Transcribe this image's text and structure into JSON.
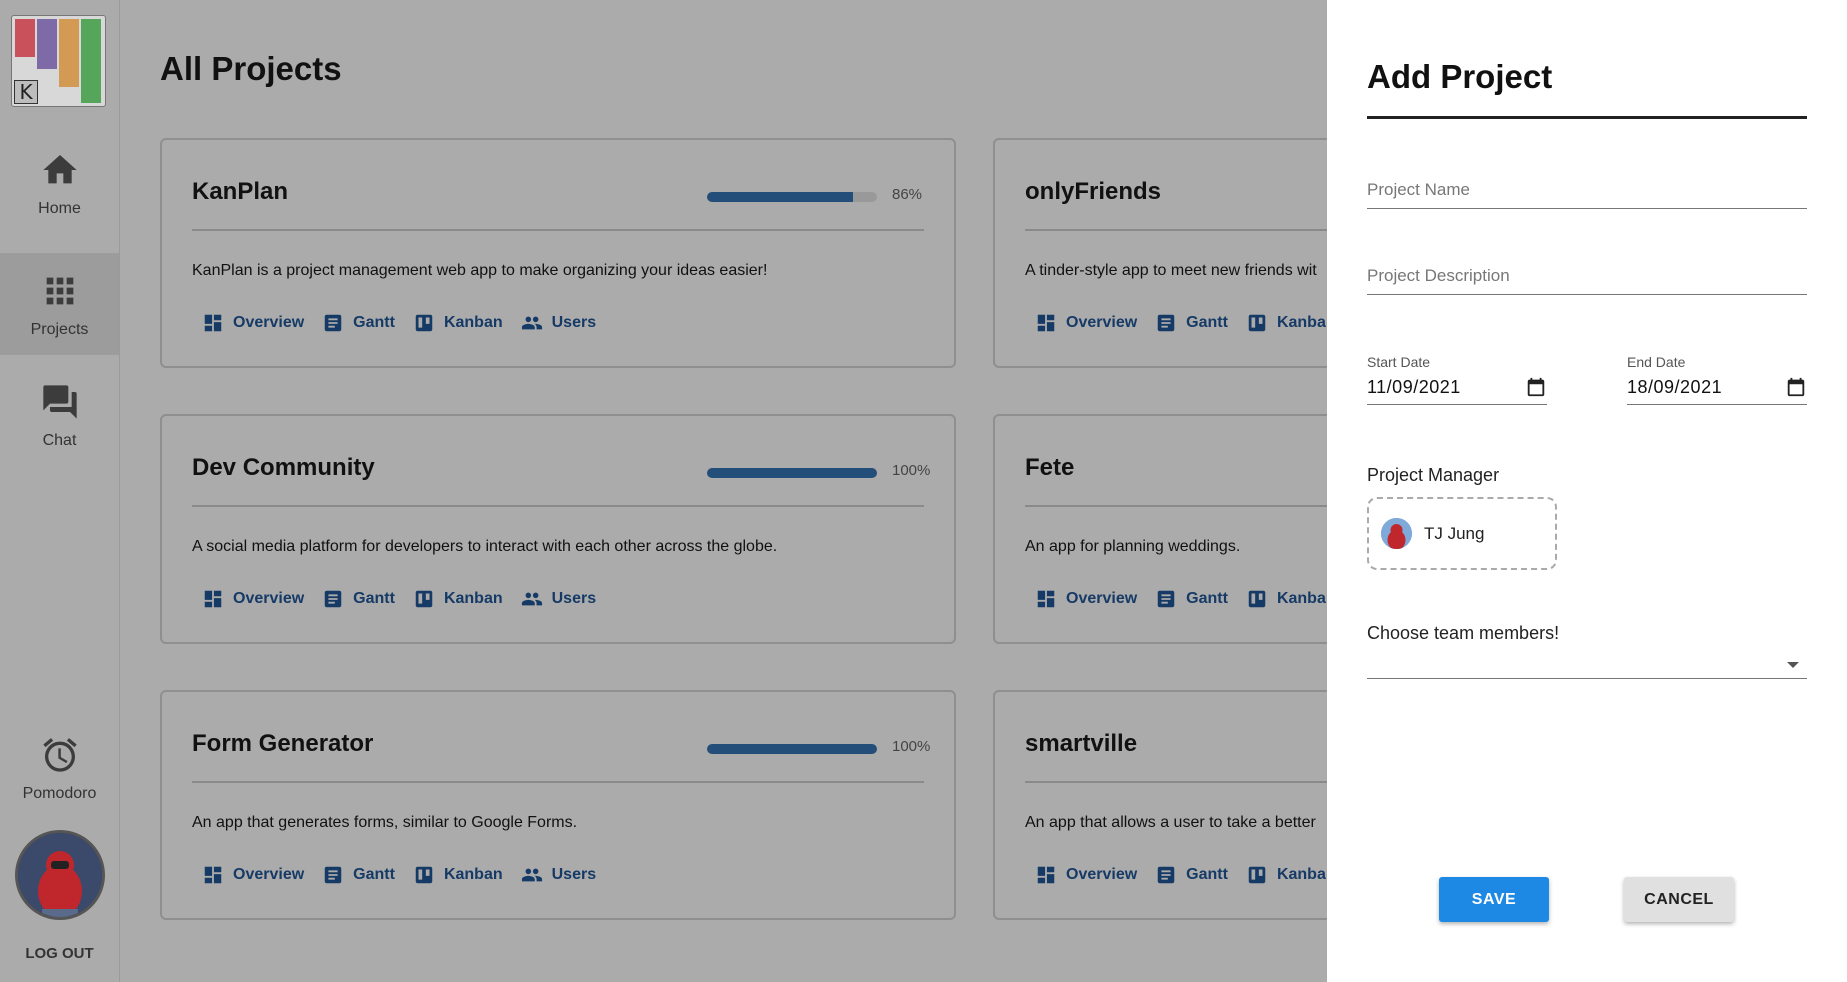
{
  "sidebar": {
    "logo_letter": "K",
    "logo_colors": [
      "#c8515b",
      "#7d6aa6",
      "#d29a52",
      "#55a55b"
    ],
    "items": [
      {
        "label": "Home",
        "icon": "home-icon"
      },
      {
        "label": "Projects",
        "icon": "apps-grid-icon",
        "active": true
      },
      {
        "label": "Chat",
        "icon": "chat-icon"
      }
    ],
    "pomodoro_label": "Pomodoro",
    "logout_label": "LOG OUT"
  },
  "main": {
    "title": "All Projects",
    "link_labels": {
      "overview": "Overview",
      "gantt": "Gantt",
      "kanban": "Kanban",
      "users": "Users"
    },
    "projects": [
      {
        "name": "KanPlan",
        "progress_pct": "86%",
        "progress": 0.86,
        "description": "KanPlan is a project management web app to make organizing your ideas easier!"
      },
      {
        "name": "onlyFriends",
        "description": "A tinder-style app to meet new friends wit"
      },
      {
        "name": "Dev Community",
        "progress_pct": "100%",
        "progress": 1.0,
        "description": "A social media platform for developers to interact with each other across the globe."
      },
      {
        "name": "Fete",
        "description": "An app for planning weddings."
      },
      {
        "name": "Form Generator",
        "progress_pct": "100%",
        "progress": 1.0,
        "description": "An app that generates forms, similar to Google Forms."
      },
      {
        "name": "smartville",
        "description": "An app that allows a user to take a better"
      }
    ]
  },
  "drawer": {
    "title": "Add Project",
    "project_name_placeholder": "Project Name",
    "project_description_placeholder": "Project Description",
    "start_date_label": "Start Date",
    "start_date_value": "11/09/2021",
    "end_date_label": "End Date",
    "end_date_value": "18/09/2021",
    "project_manager_label": "Project Manager",
    "project_manager_name": "TJ Jung",
    "team_members_label": "Choose team members!",
    "save_label": "SAVE",
    "cancel_label": "CANCEL"
  },
  "colors": {
    "accent": "#1e88e5",
    "link": "#163a66",
    "progress": "#234e7a"
  }
}
